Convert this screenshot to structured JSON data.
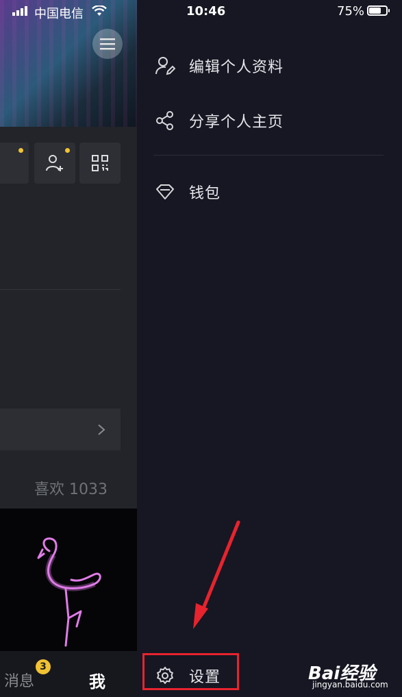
{
  "status_bar": {
    "carrier": "中国电信",
    "time": "10:46",
    "battery_percent": "75%",
    "battery_level": 0.75
  },
  "background_profile": {
    "likes_text": "喜欢 1033",
    "nav": {
      "messages_label": "消息",
      "messages_badge": "3",
      "me_label": "我"
    }
  },
  "drawer": {
    "items": [
      {
        "label": "编辑个人资料",
        "icon": "edit-profile-icon"
      },
      {
        "label": "分享个人主页",
        "icon": "share-icon"
      },
      {
        "label": "钱包",
        "icon": "wallet-diamond-icon"
      }
    ],
    "settings_label": "设置",
    "settings_icon": "gear-icon"
  },
  "watermark": {
    "brand": "Bai经验",
    "url": "jingyan.baidu.com"
  },
  "colors": {
    "drawer_bg": "#161722",
    "highlight_red": "#e8232e",
    "badge_yellow": "#f1c232"
  }
}
